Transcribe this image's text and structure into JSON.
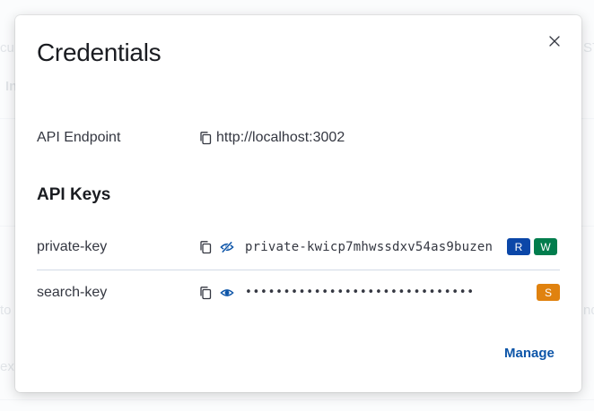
{
  "background": {
    "fragments": [
      {
        "text": "cu"
      },
      {
        "text": "In"
      },
      {
        "text": "ST"
      },
      {
        "text": "to"
      },
      {
        "text": "nd"
      },
      {
        "text": "ex"
      }
    ]
  },
  "modal": {
    "title": "Credentials",
    "endpoint": {
      "label": "API Endpoint",
      "value": "http://localhost:3002"
    },
    "api_keys_title": "API Keys",
    "keys": [
      {
        "name": "private-key",
        "value": "private-kwicp7mhwssdxv54as9buzen",
        "visibility_icon": "eye-closed-icon",
        "badges": [
          {
            "label": "R",
            "color": "#0b47a8"
          },
          {
            "label": "W",
            "color": "#017d4d"
          }
        ]
      },
      {
        "name": "search-key",
        "value": "••••••••••••••••••••••••••••••",
        "visibility_icon": "eye-icon",
        "badges": [
          {
            "label": "S",
            "color": "#e0820f"
          }
        ]
      }
    ],
    "manage_label": "Manage"
  }
}
